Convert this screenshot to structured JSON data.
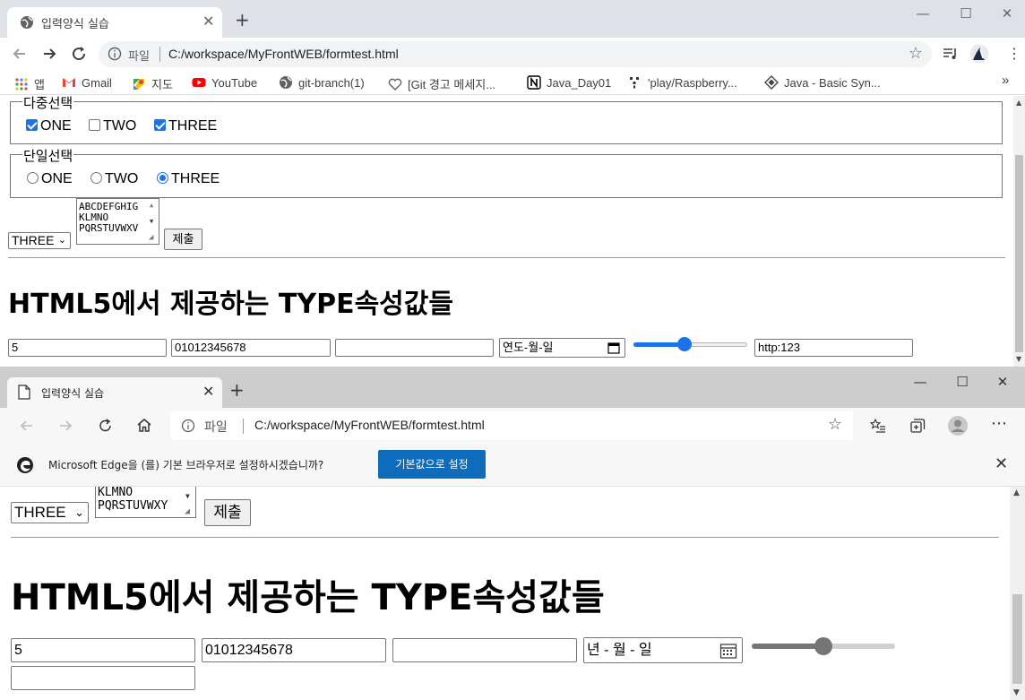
{
  "accent": "#1a73e8",
  "chrome": {
    "tab": {
      "title": "입력양식 실습",
      "favicon": "globe-icon"
    },
    "omnibox": {
      "chip": "파일",
      "url": "C:/workspace/MyFrontWEB/formtest.html"
    },
    "bookmarks": [
      {
        "label": "앱",
        "icon": "apps-grid-icon"
      },
      {
        "label": "Gmail",
        "icon": "gmail-icon"
      },
      {
        "label": "지도",
        "icon": "maps-icon"
      },
      {
        "label": "YouTube",
        "icon": "youtube-icon"
      },
      {
        "label": "git-branch(1)",
        "icon": "globe-icon"
      },
      {
        "label": "[Git 경고 메세지...",
        "icon": "heart-icon"
      },
      {
        "label": "Java_Day01",
        "icon": "notion-icon"
      },
      {
        "label": "'play/Raspberry...",
        "icon": "raspberry-icon"
      },
      {
        "label": "Java - Basic Syn...",
        "icon": "diamond-icon"
      }
    ],
    "more": "»",
    "page": {
      "multi_legend": "다중선택",
      "checkboxes": [
        {
          "label": "ONE",
          "checked": true
        },
        {
          "label": "TWO",
          "checked": false
        },
        {
          "label": "THREE",
          "checked": true
        }
      ],
      "single_legend": "단일선택",
      "radios": [
        {
          "label": "ONE",
          "checked": false
        },
        {
          "label": "TWO",
          "checked": false
        },
        {
          "label": "THREE",
          "checked": true
        }
      ],
      "select_value": "THREE",
      "listbox_lines": [
        "ABCDEFGHIG",
        "KLMNO",
        "PQRSTUVWXV"
      ],
      "submit": "제출",
      "heading": "HTML5에서 제공하는 TYPE속성값들",
      "number_value": "5",
      "tel_value": "01012345678",
      "email_value": "",
      "date_placeholder": "연도-월-일",
      "range_percent": 44,
      "url_value": "http:123"
    }
  },
  "edge": {
    "tab": {
      "title": "입력양식 실습",
      "favicon": "page-icon"
    },
    "omnibox": {
      "chip": "파일",
      "url": "C:/workspace/MyFrontWEB/formtest.html"
    },
    "infobar": {
      "message": "Microsoft Edge을 (를) 기본 브라우저로 설정하시겠습니까?",
      "button": "기본값으로 설정"
    },
    "page": {
      "listbox_lines": [
        "KLMNO",
        "PQRSTUVWXY"
      ],
      "select_value": "THREE",
      "submit": "제출",
      "heading": "HTML5에서 제공하는 TYPE속성값들",
      "number_value": "5",
      "tel_value": "01012345678",
      "email_value": "",
      "date_placeholder": "년 - 월 - 일",
      "range_percent": 50,
      "url_value": ""
    }
  }
}
